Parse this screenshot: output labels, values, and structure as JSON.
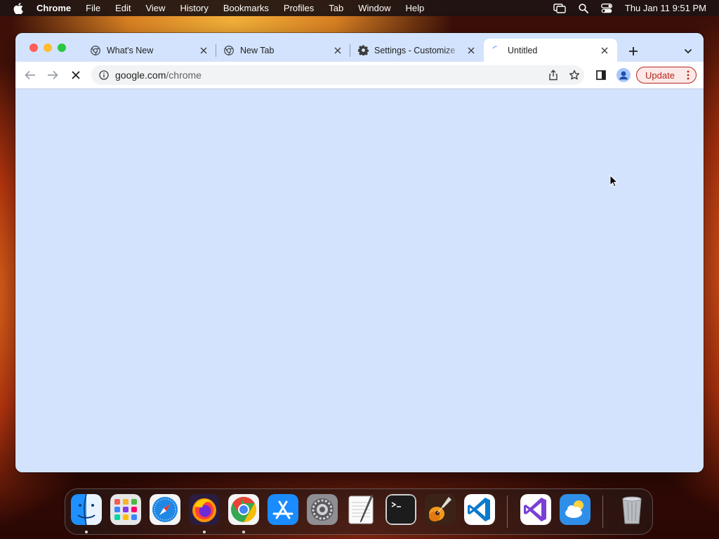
{
  "menubar": {
    "app_name": "Chrome",
    "items": [
      "File",
      "Edit",
      "View",
      "History",
      "Bookmarks",
      "Profiles",
      "Tab",
      "Window",
      "Help"
    ],
    "clock": "Thu Jan 11  9:51 PM"
  },
  "tabs": [
    {
      "label": "What's New",
      "icon": "chrome-icon"
    },
    {
      "label": "New Tab",
      "icon": "chrome-icon"
    },
    {
      "label": "Settings - Customize",
      "icon": "gear-icon"
    },
    {
      "label": "Untitled",
      "icon": "loading-spinner-icon",
      "active": true
    }
  ],
  "toolbar": {
    "url_domain": "google.com",
    "url_path": "/chrome",
    "update_label": "Update"
  },
  "dock": {
    "apps": [
      "Finder",
      "Launchpad",
      "Safari",
      "Firefox",
      "Chrome",
      "App Store",
      "System Settings",
      "TextEdit",
      "Terminal",
      "GarageBand",
      "Visual Studio Code",
      "Visual Studio",
      "Weather",
      "Trash"
    ]
  },
  "colors": {
    "content_background": "#d3e3fd",
    "update_accent": "#b3261e"
  }
}
